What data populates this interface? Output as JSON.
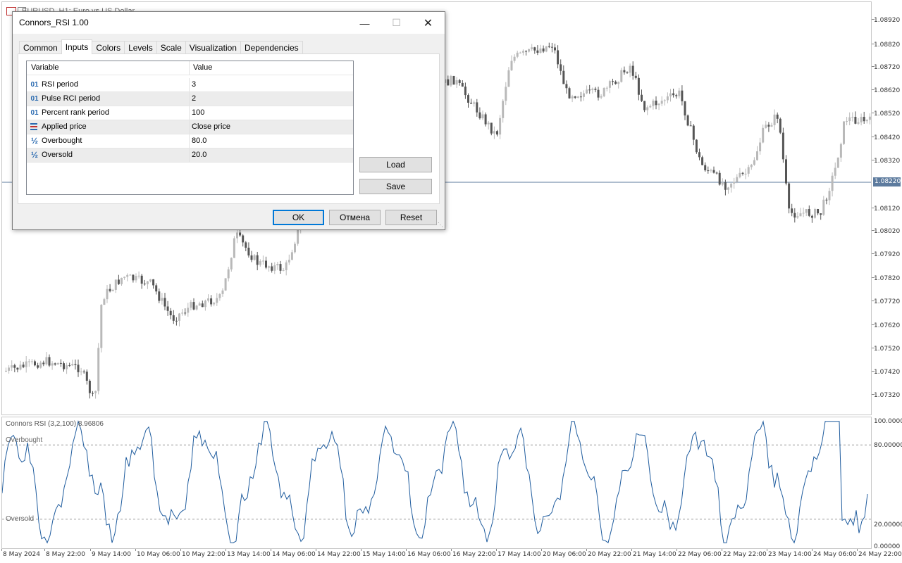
{
  "chart": {
    "caption": "EURUSD, H1:  Euro vs US Dollar",
    "indicator_caption": "Connors RSI (3,2,100) 8.96806",
    "level_overbought": "Overbought",
    "level_oversold": "Oversold",
    "current_price": "1.08220",
    "price_axis": [
      "1.08920",
      "1.08820",
      "1.08720",
      "1.08620",
      "1.08520",
      "1.08420",
      "1.08320",
      "1.08120",
      "1.08020",
      "1.07920",
      "1.07820",
      "1.07720",
      "1.07620",
      "1.07520",
      "1.07420",
      "1.07320"
    ],
    "indicator_axis": [
      "100.00000",
      "80.00000",
      "20.00000",
      "0.00000"
    ],
    "time_axis": [
      "8 May 2024",
      "8 May 22:00",
      "9 May 14:00",
      "10 May 06:00",
      "10 May 22:00",
      "13 May 14:00",
      "14 May 06:00",
      "14 May 22:00",
      "15 May 14:00",
      "16 May 06:00",
      "16 May 22:00",
      "17 May 14:00",
      "20 May 06:00",
      "20 May 22:00",
      "21 May 14:00",
      "22 May 06:00",
      "22 May 22:00",
      "23 May 14:00",
      "24 May 06:00",
      "24 May 22:00"
    ]
  },
  "dialog": {
    "title": "Connors_RSI 1.00",
    "tabs": [
      {
        "label": "Common"
      },
      {
        "label": "Inputs"
      },
      {
        "label": "Colors"
      },
      {
        "label": "Levels"
      },
      {
        "label": "Scale"
      },
      {
        "label": "Visualization"
      },
      {
        "label": "Dependencies"
      }
    ],
    "active_tab": "Inputs",
    "table": {
      "col_variable": "Variable",
      "col_value": "Value",
      "rows": [
        {
          "icon": "int-icon",
          "variable": "RSI period",
          "value": "3"
        },
        {
          "icon": "int-icon",
          "variable": "Pulse RCI period",
          "value": "2"
        },
        {
          "icon": "int-icon",
          "variable": "Percent rank period",
          "value": "100"
        },
        {
          "icon": "enum-icon",
          "variable": "Applied price",
          "value": "Close price"
        },
        {
          "icon": "double-icon",
          "variable": "Overbought",
          "value": "80.0"
        },
        {
          "icon": "double-icon",
          "variable": "Oversold",
          "value": "20.0"
        }
      ]
    },
    "load_label": "Load",
    "save_label": "Save",
    "ok_label": "OK",
    "cancel_label": "Отмена",
    "reset_label": "Reset"
  },
  "colors": {
    "indicator_line": "#1f5c9e",
    "bull_candle": "#b9b9b9",
    "bear_candle": "#555555",
    "price_line": "#5d7b9e",
    "accent": "#0078d7"
  }
}
